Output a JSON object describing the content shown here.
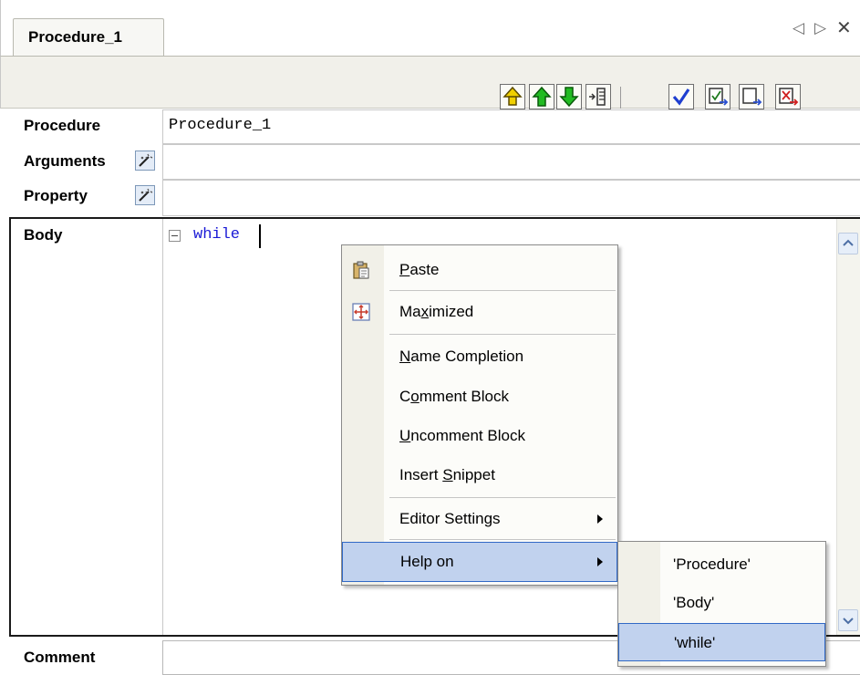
{
  "tab": {
    "title": "Procedure_1",
    "prev_glyph": "◁",
    "next_glyph": "▷",
    "close_glyph": "✕"
  },
  "toolbar": {
    "buttons": [
      {
        "name": "move-to-top-icon"
      },
      {
        "name": "move-up-icon"
      },
      {
        "name": "move-down-icon"
      },
      {
        "name": "indent-icon"
      },
      {
        "name": "check-icon"
      },
      {
        "name": "apply-icon"
      },
      {
        "name": "export-icon"
      },
      {
        "name": "delete-export-icon"
      }
    ]
  },
  "form": {
    "procedure_label": "Procedure",
    "procedure_value": "Procedure_1",
    "arguments_label": "Arguments",
    "property_label": "Property",
    "body_label": "Body",
    "comment_label": "Comment"
  },
  "editor": {
    "code": "while"
  },
  "context_menu": {
    "paste": "Paste",
    "maximized": "Maximized",
    "name_completion": "Name Completion",
    "comment_block": "Comment Block",
    "uncomment_block": "Uncomment Block",
    "insert_snippet": "Insert Snippet",
    "editor_settings": "Editor Settings",
    "help_on": "Help on"
  },
  "help_submenu": {
    "items": [
      "'Procedure'",
      "'Body'",
      "'while'"
    ],
    "highlighted_index": 2
  },
  "colors": {
    "highlight_bg": "#c1d2ee",
    "highlight_border": "#3169c6",
    "keyword": "#1a1ad6",
    "toolbar_bg": "#f1f0ea"
  }
}
